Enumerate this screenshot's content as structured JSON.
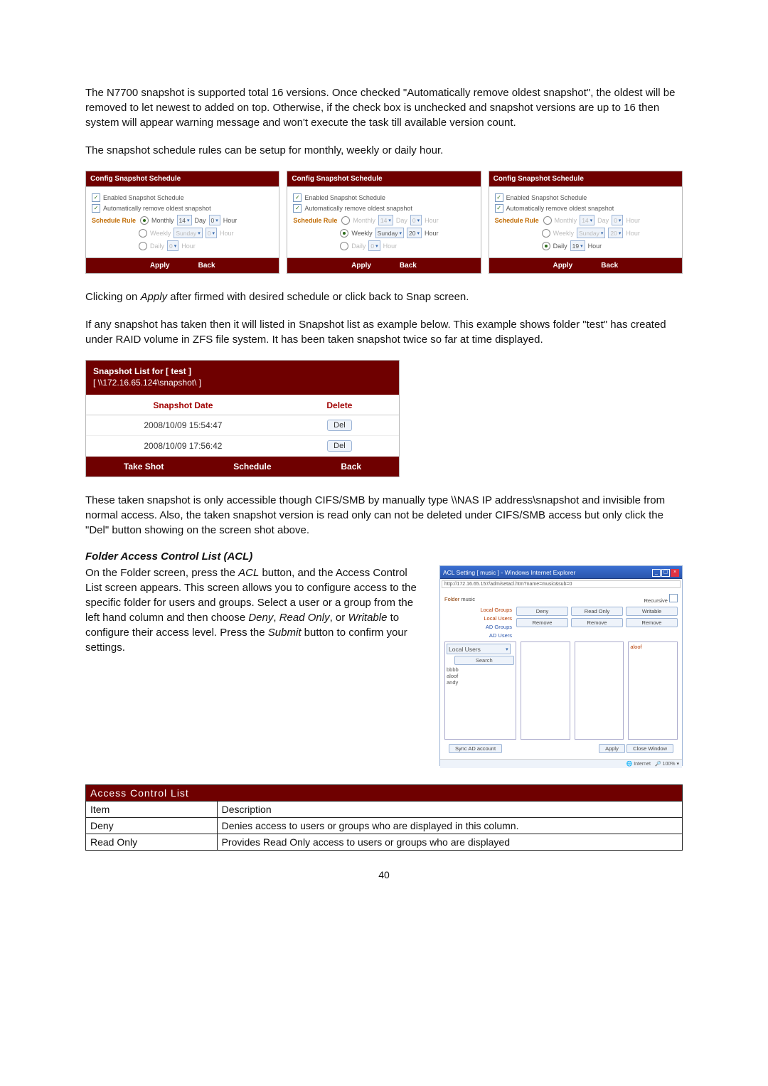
{
  "intro": {
    "p1": "The N7700 snapshot is supported total 16 versions. Once checked \"Automatically remove oldest snapshot\", the oldest will be removed to let newest to added on top. Otherwise, if the check box is unchecked and snapshot versions are up to 16 then system will appear warning message and won't execute the task till available version count.",
    "p2": "The snapshot schedule rules can be setup for monthly, weekly or daily hour."
  },
  "schedule": {
    "head": "Config Snapshot Schedule",
    "enabled": "Enabled Snapshot Schedule",
    "auto_remove": "Automatically remove oldest snapshot",
    "rule_label": "Schedule Rule",
    "monthly": "Monthly",
    "weekly": "Weekly",
    "daily": "Daily",
    "day_word": "Day",
    "hour_word": "Hour",
    "weekday": "Sunday",
    "apply": "Apply",
    "back": "Back",
    "panels": [
      {
        "selected": "monthly",
        "month_day": "14",
        "month_hour": "0",
        "week_hour": "0",
        "daily_hour": "0"
      },
      {
        "selected": "weekly",
        "month_day": "14",
        "month_hour": "0",
        "week_hour": "20",
        "daily_hour": "0"
      },
      {
        "selected": "daily",
        "month_day": "14",
        "month_hour": "0",
        "week_hour": "20",
        "daily_hour": "19"
      }
    ]
  },
  "after_schedule": {
    "p1a": "Clicking on ",
    "apply_word": "Apply",
    "p1b": " after firmed with desired schedule or click back to Snap screen.",
    "p2": "If any snapshot has taken then it will listed in Snapshot list as example below. This example shows folder \"test\" has created under RAID volume in ZFS file system. It has been taken snapshot twice so far at time displayed."
  },
  "snapshot_list": {
    "title": "Snapshot List for [ test ]",
    "path": "[ \\\\172.16.65.124\\snapshot\\ ]",
    "col_date": "Snapshot Date",
    "col_delete": "Delete",
    "del_label": "Del",
    "rows": [
      "2008/10/09 15:54:47",
      "2008/10/09 17:56:42"
    ],
    "btn_take": "Take Shot",
    "btn_schedule": "Schedule",
    "btn_back": "Back"
  },
  "after_list": {
    "p1": "These taken snapshot is only accessible though CIFS/SMB by manually type \\\\NAS IP address\\snapshot and invisible from normal access. Also, the taken snapshot version is read only can not be deleted under CIFS/SMB access but only click the \"Del\" button showing on the screen shot above."
  },
  "acl_section": {
    "heading": "Folder Access Control List (ACL)",
    "para_a": "On the Folder screen, press the ",
    "acl_word": "ACL",
    "para_b": " button, and the Access Control List screen appears. This screen allows you to configure access to the specific folder for users and groups. Select a user or a group from the left hand column and then choose ",
    "deny_word": "Deny",
    "comma": ", ",
    "readonly_word": "Read Only",
    "or": ", or ",
    "writable_word": "Writable",
    "para_c": " to configure their access level. Press the ",
    "submit_word": "Submit",
    "para_d": " button to confirm your settings."
  },
  "acl_window": {
    "title": "ACL Setting [ music ] - Windows Internet Explorer",
    "url": "http://172.16.65.157/adm/setacl.htm?name=music&sub=0",
    "folder_label": "Folder",
    "folder_value": "music",
    "recursive": "Recursive",
    "local_groups": "Local Groups",
    "local_users": "Local Users",
    "ad_groups": "AD Groups",
    "ad_users": "AD Users",
    "search": "Search",
    "select_label": "Local Users",
    "deny": "Deny",
    "read_only": "Read Only",
    "writable": "Writable",
    "remove": "Remove",
    "list_users": [
      "bbbb",
      "aloof",
      "andy"
    ],
    "right_user": "aloof",
    "sync": "Sync AD account",
    "apply": "Apply",
    "close": "Close Window",
    "status_zone": "Internet",
    "status_zoom": "100%"
  },
  "acl_table": {
    "title": "Access Control List",
    "h_item": "Item",
    "h_desc": "Description",
    "rows": [
      {
        "item": "Deny",
        "desc": "Denies access to users or groups who are displayed in this column."
      },
      {
        "item": "Read Only",
        "desc": "Provides Read Only access to users or groups who are displayed"
      }
    ]
  },
  "page_number": "40"
}
